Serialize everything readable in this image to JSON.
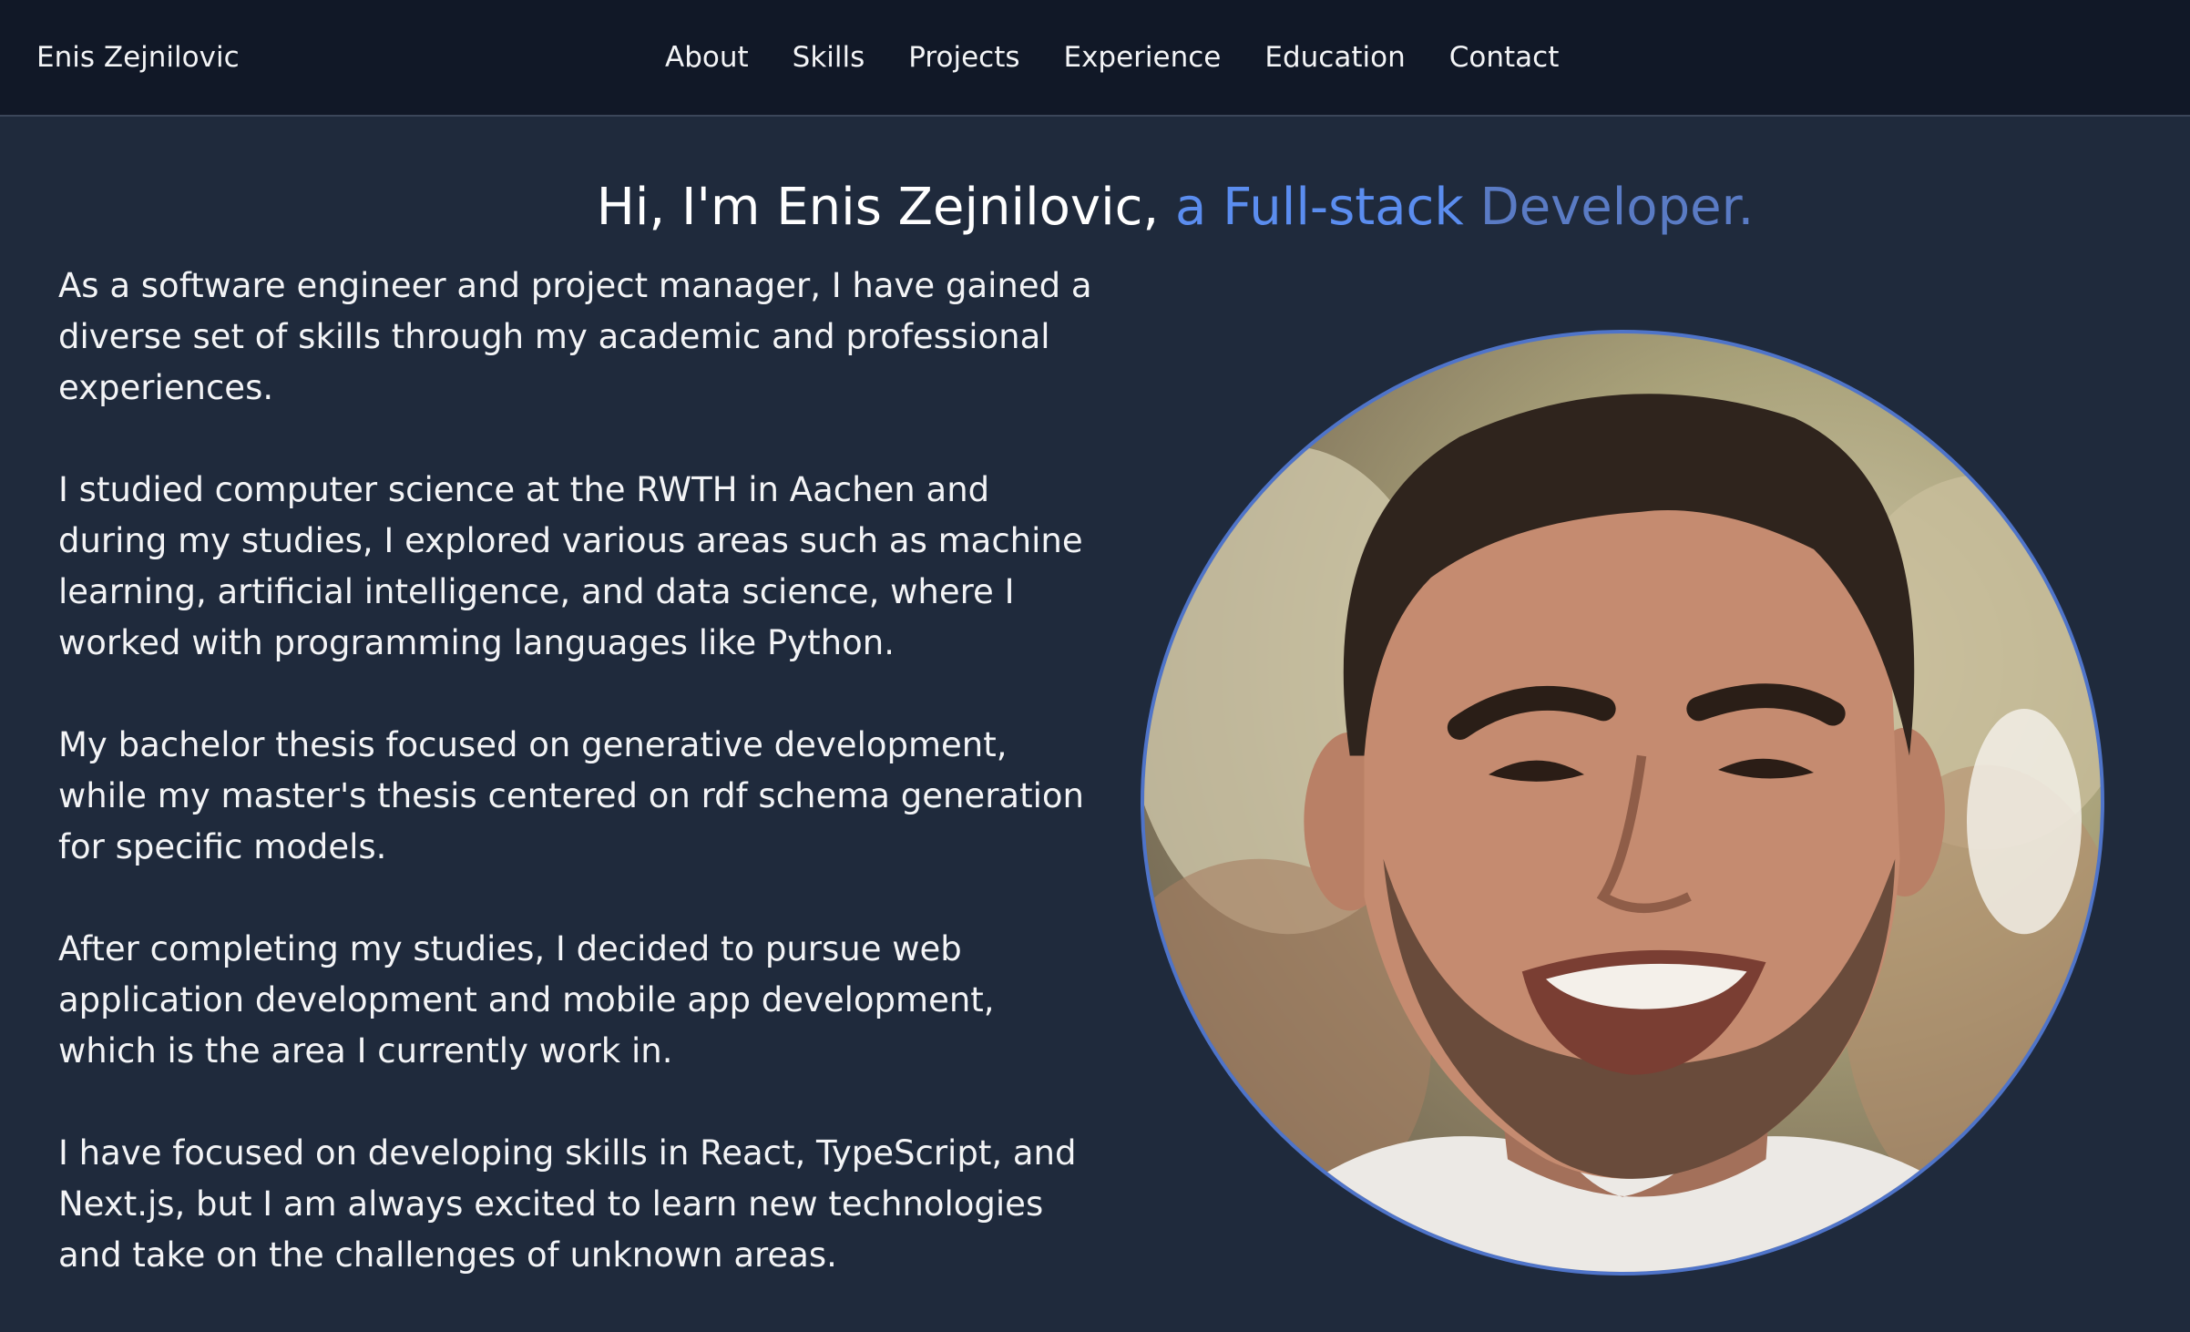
{
  "nav": {
    "brand": "Enis Zejnilovic",
    "links": [
      "About",
      "Skills",
      "Projects",
      "Experience",
      "Education",
      "Contact"
    ]
  },
  "hero": {
    "intro": "Hi, I'm Enis Zejnilovic,",
    "role_part1": " a Full-stack",
    "role_part2": " Developer."
  },
  "about": {
    "paragraphs": [
      "As a software engineer and project manager, I have gained a diverse set of skills through my academic and professional experiences.",
      "I studied computer science at the RWTH in Aachen and during my studies, I explored various areas such as machine learning, artificial intelligence, and data science, where I worked with programming languages like Python.",
      "My bachelor thesis focused on generative development, while my master's thesis centered on rdf schema generation for specific models.",
      "After completing my studies, I decided to pursue web application development and mobile app development, which is the area I currently work in.",
      "I have focused on developing skills in React, TypeScript, and Next.js, but I am always excited to learn new technologies and take on the challenges of unknown areas."
    ]
  },
  "colors": {
    "background": "#1f2a3c",
    "navbar": "#111827",
    "accent": "#5b8def",
    "ring": "#4f74c9"
  },
  "icons": {
    "portrait": "profile-photo"
  }
}
